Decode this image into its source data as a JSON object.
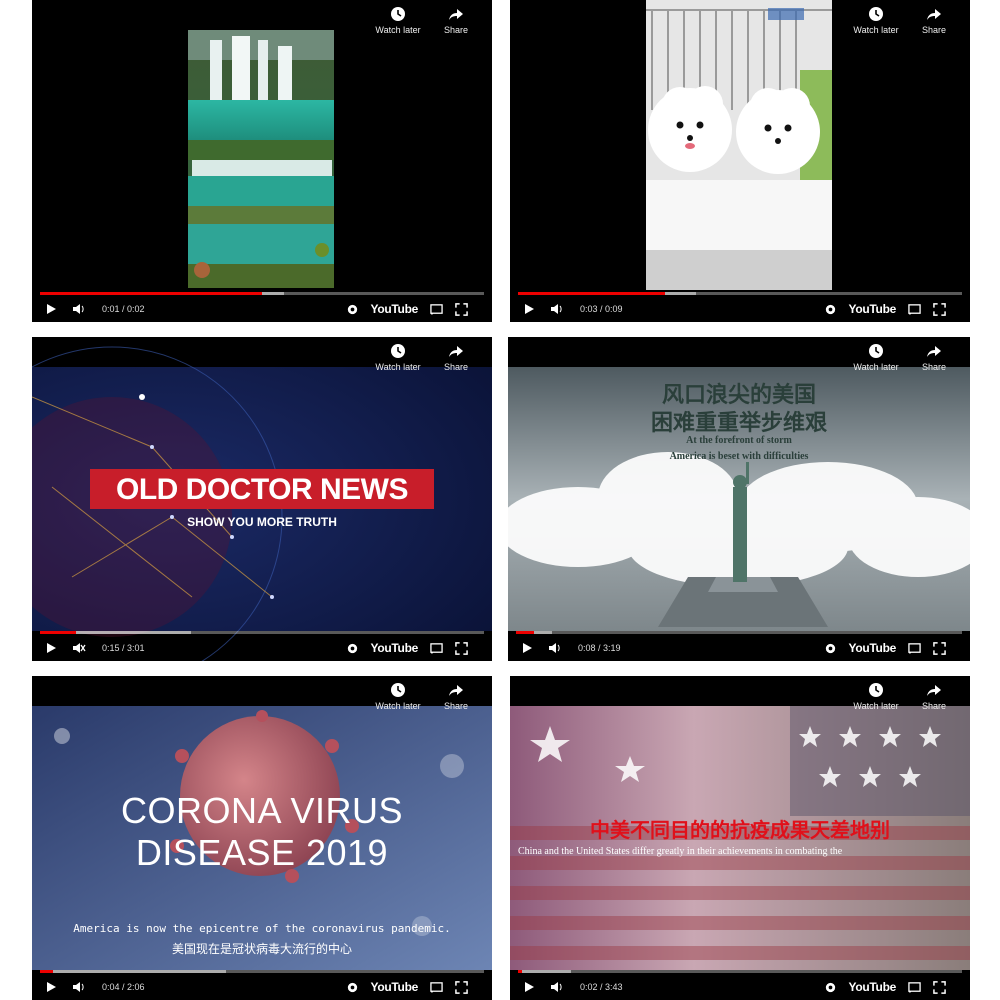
{
  "common": {
    "watch_later": "Watch later",
    "share": "Share",
    "youtube_logo": "YouTube"
  },
  "players": [
    {
      "id": 1,
      "time": "0:01 / 0:02",
      "progress": 0.5
    },
    {
      "id": 2,
      "time": "0:03 / 0:09",
      "progress": 0.33
    },
    {
      "id": 3,
      "time": "0:15 / 3:01",
      "progress": 0.08,
      "overlay_title": "OLD DOCTOR NEWS",
      "overlay_subtitle": "SHOW YOU MORE TRUTH"
    },
    {
      "id": 4,
      "time": "0:08 / 3:19",
      "progress": 0.04,
      "overlay_cn_line1": "风口浪尖的美国",
      "overlay_cn_line2": "困难重重举步维艰",
      "overlay_en_line1": "At the forefront of storm",
      "overlay_en_line2": "America is beset with difficulties"
    },
    {
      "id": 5,
      "time": "0:04 / 2:06",
      "progress": 0.03,
      "overlay_title_line1": "CORONA VIRUS",
      "overlay_title_line2": "DISEASE 2019",
      "subtitle_en": "America is now the epicentre of the coronavirus pandemic.",
      "subtitle_cn": "美国现在是冠状病毒大流行的中心"
    },
    {
      "id": 6,
      "time": "0:02 / 3:43",
      "progress": 0.01,
      "overlay_cn": "中美不同目的的抗疫成果天差地别",
      "overlay_en": "China and the United States differ greatly in their achievements in combating the"
    }
  ]
}
